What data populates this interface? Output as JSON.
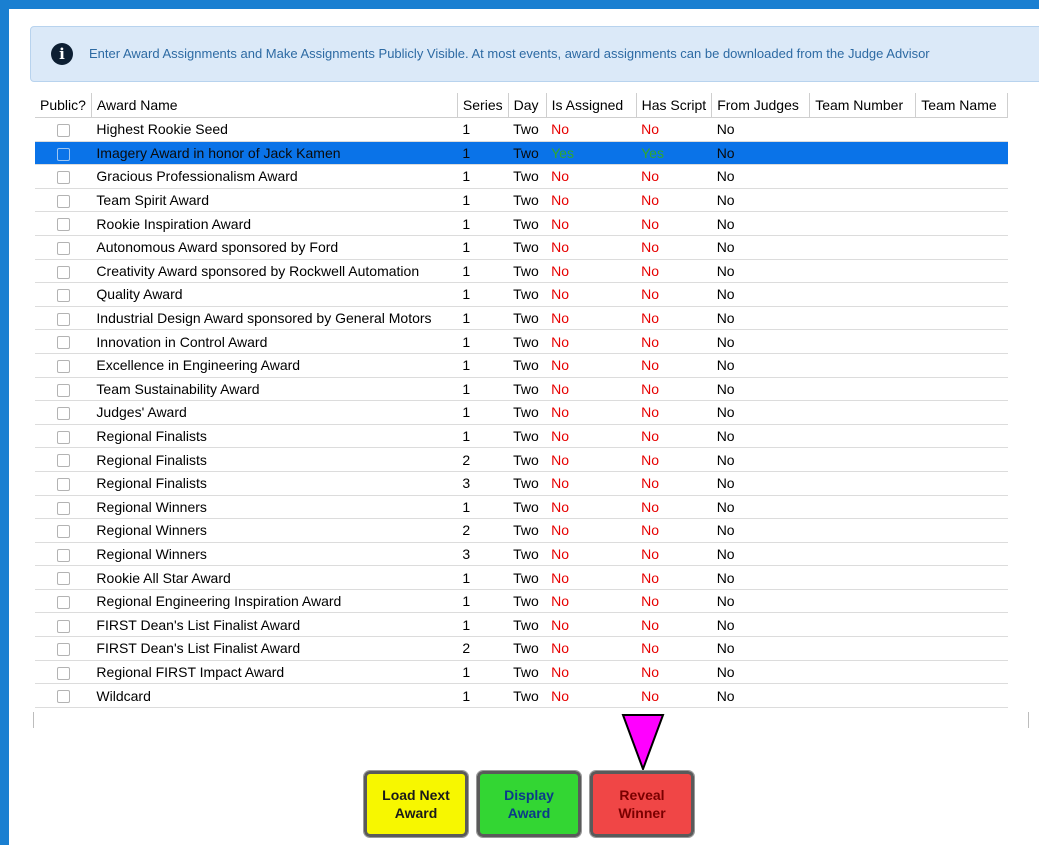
{
  "info": {
    "message": "Enter Award Assignments and Make Assignments Publicly Visible. At most events, award assignments can be downloaded from the Judge Advisor"
  },
  "table": {
    "headers": {
      "public": "Public?",
      "name": "Award Name",
      "series": "Series",
      "day": "Day",
      "assigned": "Is Assigned",
      "script": "Has Script",
      "judges": "From Judges",
      "team_number": "Team Number",
      "team_name": "Team Name"
    },
    "rows": [
      {
        "name": "Highest Rookie Seed",
        "series": "1",
        "day": "Two",
        "assigned": "No",
        "script": "No",
        "judges": "No"
      },
      {
        "name": "Imagery Award in honor of Jack Kamen",
        "series": "1",
        "day": "Two",
        "assigned": "Yes",
        "script": "Yes",
        "judges": "No"
      },
      {
        "name": "Gracious Professionalism Award",
        "series": "1",
        "day": "Two",
        "assigned": "No",
        "script": "No",
        "judges": "No"
      },
      {
        "name": "Team Spirit Award",
        "series": "1",
        "day": "Two",
        "assigned": "No",
        "script": "No",
        "judges": "No"
      },
      {
        "name": "Rookie Inspiration Award",
        "series": "1",
        "day": "Two",
        "assigned": "No",
        "script": "No",
        "judges": "No"
      },
      {
        "name": "Autonomous Award sponsored by Ford",
        "series": "1",
        "day": "Two",
        "assigned": "No",
        "script": "No",
        "judges": "No"
      },
      {
        "name": "Creativity Award sponsored by Rockwell Automation",
        "series": "1",
        "day": "Two",
        "assigned": "No",
        "script": "No",
        "judges": "No"
      },
      {
        "name": "Quality Award",
        "series": "1",
        "day": "Two",
        "assigned": "No",
        "script": "No",
        "judges": "No"
      },
      {
        "name": "Industrial Design Award sponsored by General Motors",
        "series": "1",
        "day": "Two",
        "assigned": "No",
        "script": "No",
        "judges": "No"
      },
      {
        "name": "Innovation in Control Award",
        "series": "1",
        "day": "Two",
        "assigned": "No",
        "script": "No",
        "judges": "No"
      },
      {
        "name": "Excellence in Engineering Award",
        "series": "1",
        "day": "Two",
        "assigned": "No",
        "script": "No",
        "judges": "No"
      },
      {
        "name": "Team Sustainability Award",
        "series": "1",
        "day": "Two",
        "assigned": "No",
        "script": "No",
        "judges": "No"
      },
      {
        "name": "Judges' Award",
        "series": "1",
        "day": "Two",
        "assigned": "No",
        "script": "No",
        "judges": "No"
      },
      {
        "name": "Regional Finalists",
        "series": "1",
        "day": "Two",
        "assigned": "No",
        "script": "No",
        "judges": "No"
      },
      {
        "name": "Regional Finalists",
        "series": "2",
        "day": "Two",
        "assigned": "No",
        "script": "No",
        "judges": "No"
      },
      {
        "name": "Regional Finalists",
        "series": "3",
        "day": "Two",
        "assigned": "No",
        "script": "No",
        "judges": "No"
      },
      {
        "name": "Regional Winners",
        "series": "1",
        "day": "Two",
        "assigned": "No",
        "script": "No",
        "judges": "No"
      },
      {
        "name": "Regional Winners",
        "series": "2",
        "day": "Two",
        "assigned": "No",
        "script": "No",
        "judges": "No"
      },
      {
        "name": "Regional Winners",
        "series": "3",
        "day": "Two",
        "assigned": "No",
        "script": "No",
        "judges": "No"
      },
      {
        "name": "Rookie All Star Award",
        "series": "1",
        "day": "Two",
        "assigned": "No",
        "script": "No",
        "judges": "No"
      },
      {
        "name": "Regional Engineering Inspiration Award",
        "series": "1",
        "day": "Two",
        "assigned": "No",
        "script": "No",
        "judges": "No"
      },
      {
        "name": "FIRST Dean's List Finalist Award",
        "series": "1",
        "day": "Two",
        "assigned": "No",
        "script": "No",
        "judges": "No"
      },
      {
        "name": "FIRST Dean's List Finalist Award",
        "series": "2",
        "day": "Two",
        "assigned": "No",
        "script": "No",
        "judges": "No"
      },
      {
        "name": "Regional FIRST Impact Award",
        "series": "1",
        "day": "Two",
        "assigned": "No",
        "script": "No",
        "judges": "No"
      },
      {
        "name": "Wildcard",
        "series": "1",
        "day": "Two",
        "assigned": "No",
        "script": "No",
        "judges": "No"
      }
    ],
    "selected_row": "Imagery Award in honor of Jack Kamen"
  },
  "buttons": {
    "load_next": "Load Next Award",
    "display": "Display Award",
    "reveal": "Reveal Winner"
  },
  "colors": {
    "accent": "#1a7fd1",
    "selected_row": "#0a73e8",
    "no": "#e60000",
    "yes": "#20a020",
    "load_button": "#f7f700",
    "display_button": "#33d633",
    "reveal_button": "#f04646",
    "pointer": "#ff00ff"
  }
}
